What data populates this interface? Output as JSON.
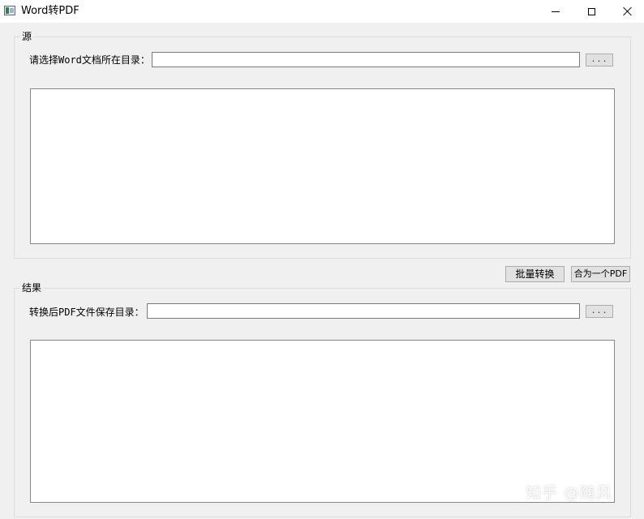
{
  "window": {
    "title": "Word转PDF"
  },
  "source_group": {
    "title": "源",
    "label": "请选择Word文档所在目录：",
    "input_value": "",
    "browse_label": "..."
  },
  "actions": {
    "batch_convert_label": "批量转换",
    "merge_label": "合为一个PDF"
  },
  "result_group": {
    "title": "结果",
    "label": "转换后PDF文件保存目录：",
    "input_value": "",
    "browse_label": "..."
  },
  "watermark": {
    "text": "知乎 @随风"
  },
  "icons": {
    "app": "app-window-icon",
    "minimize": "minimize-icon",
    "maximize": "maximize-icon",
    "close": "close-icon"
  }
}
